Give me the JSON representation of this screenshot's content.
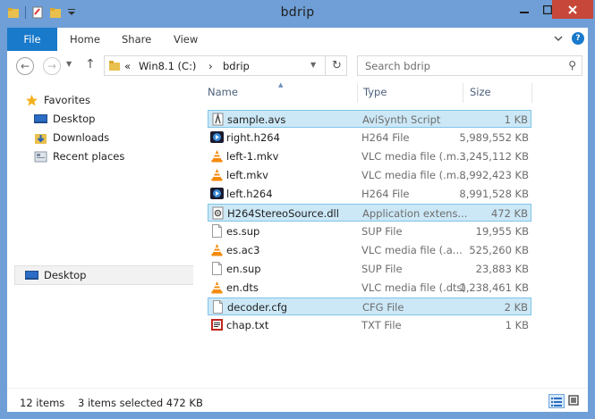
{
  "window": {
    "title": "bdrip"
  },
  "ribbon": {
    "tabs": [
      "File",
      "Home",
      "Share",
      "View"
    ],
    "help": "?"
  },
  "nav": {
    "breadcrumb_prefix": "«",
    "crumbs": [
      "Win8.1 (C:)",
      "bdrip"
    ],
    "crumb_sep": "›",
    "search_placeholder": "Search bdrip"
  },
  "sidebar": {
    "favorites_label": "Favorites",
    "favorites": [
      "Desktop",
      "Downloads",
      "Recent places"
    ],
    "desktop_label": "Desktop"
  },
  "columns": {
    "name": "Name",
    "type": "Type",
    "size": "Size"
  },
  "files": [
    {
      "name": "sample.avs",
      "type": "AviSynth Script",
      "size": "1 KB",
      "icon": "avs-script-icon",
      "selected": true
    },
    {
      "name": "right.h264",
      "type": "H264 File",
      "size": "5,989,552 KB",
      "icon": "h264-file-icon",
      "selected": false
    },
    {
      "name": "left-1.mkv",
      "type": "VLC media file (.m...",
      "size": "3,245,112 KB",
      "icon": "vlc-cone-icon",
      "selected": false
    },
    {
      "name": "left.mkv",
      "type": "VLC media file (.m...",
      "size": "8,992,423 KB",
      "icon": "vlc-cone-icon",
      "selected": false
    },
    {
      "name": "left.h264",
      "type": "H264 File",
      "size": "8,991,528 KB",
      "icon": "h264-file-icon",
      "selected": false
    },
    {
      "name": "H264StereoSource.dll",
      "type": "Application extens...",
      "size": "472 KB",
      "icon": "dll-gear-icon",
      "selected": true
    },
    {
      "name": "es.sup",
      "type": "SUP File",
      "size": "19,955 KB",
      "icon": "blank-file-icon",
      "selected": false
    },
    {
      "name": "es.ac3",
      "type": "VLC media file (.a...",
      "size": "525,260 KB",
      "icon": "vlc-cone-icon",
      "selected": false
    },
    {
      "name": "en.sup",
      "type": "SUP File",
      "size": "23,883 KB",
      "icon": "blank-file-icon",
      "selected": false
    },
    {
      "name": "en.dts",
      "type": "VLC media file (.dts)",
      "size": "1,238,461 KB",
      "icon": "vlc-cone-icon",
      "selected": false
    },
    {
      "name": "decoder.cfg",
      "type": "CFG File",
      "size": "2 KB",
      "icon": "blank-file-icon",
      "selected": true
    },
    {
      "name": "chap.txt",
      "type": "TXT File",
      "size": "1 KB",
      "icon": "text-file-icon",
      "selected": false
    }
  ],
  "status": {
    "items": "12 items",
    "selected": "3 items selected  472 KB"
  },
  "colors": {
    "titlebar": "#6f9fd6",
    "file_tab": "#1979ca",
    "selection_fill": "#cce8f7",
    "selection_border": "#7fc4e8",
    "close": "#c7483a"
  }
}
